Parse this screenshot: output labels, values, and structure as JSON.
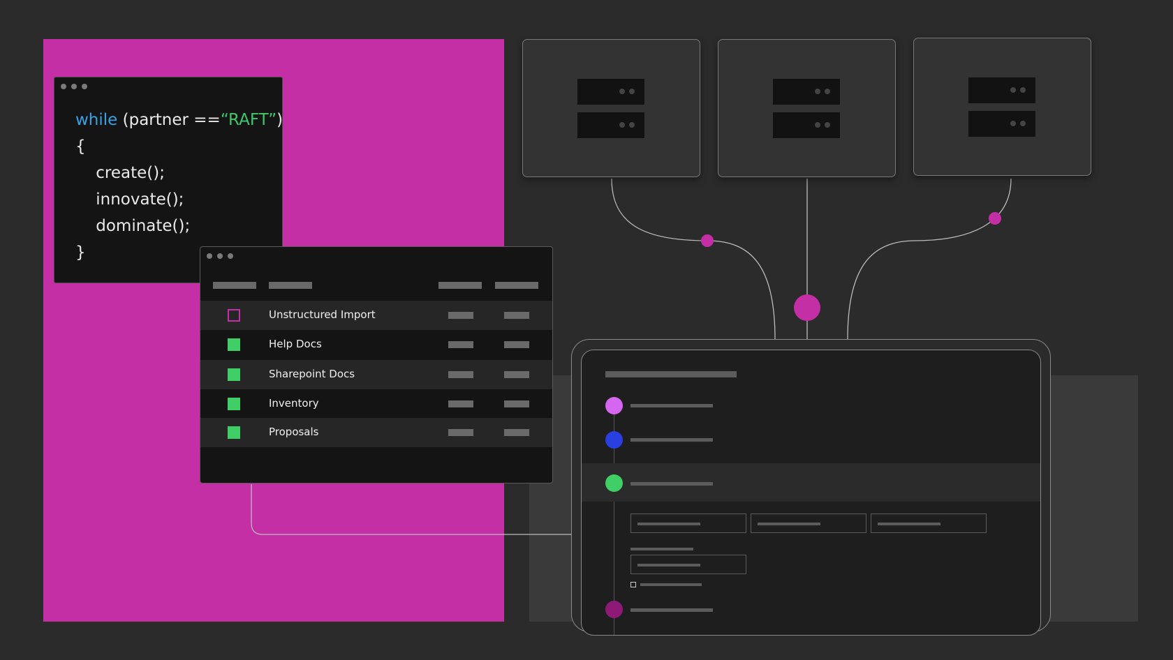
{
  "code_window": {
    "line1_keyword": "while",
    "line1_mid": " (partner ==",
    "line1_string": "“RAFT”",
    "line1_end": ")",
    "line2": "{",
    "line3": "create();",
    "line4": "innovate();",
    "line5": "dominate();",
    "line6": "}"
  },
  "table_window": {
    "rows": [
      {
        "label": "Unstructured Import",
        "checked": false
      },
      {
        "label": "Help Docs",
        "checked": true
      },
      {
        "label": "Sharepoint Docs",
        "checked": true
      },
      {
        "label": "Inventory",
        "checked": true
      },
      {
        "label": "Proposals",
        "checked": true
      }
    ]
  },
  "colors": {
    "accent_magenta": "#c42fa5",
    "keyword_blue": "#37a3e6",
    "string_green": "#3ec86b",
    "checkbox_green": "#3fcf66",
    "step_dots": [
      "#d466f0",
      "#2a3fe0",
      "#3fcf66",
      "#8e1a78"
    ]
  },
  "icons": {
    "server_units": "server-rack-icon",
    "window_controls": "window-dots-icon",
    "connector_nodes": "connector-node-icon"
  }
}
